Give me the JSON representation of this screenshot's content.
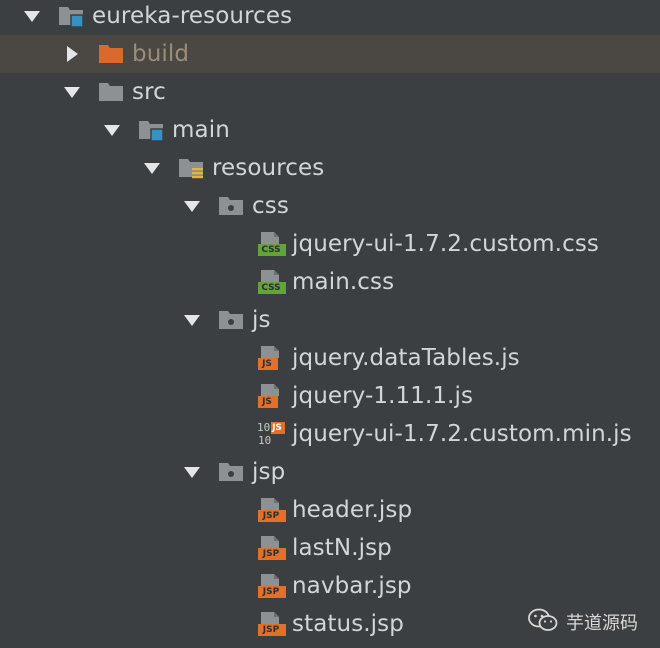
{
  "tree": [
    {
      "id": "eureka-resources",
      "label": "eureka-resources",
      "depth": 0,
      "toggle": "expanded",
      "icon": "module-folder-icon"
    },
    {
      "id": "build",
      "label": "build",
      "depth": 1,
      "toggle": "collapsed",
      "icon": "excluded-folder-icon",
      "selected": true,
      "dim": true
    },
    {
      "id": "src",
      "label": "src",
      "depth": 1,
      "toggle": "expanded",
      "icon": "folder-icon"
    },
    {
      "id": "main",
      "label": "main",
      "depth": 2,
      "toggle": "expanded",
      "icon": "source-folder-icon"
    },
    {
      "id": "resources",
      "label": "resources",
      "depth": 3,
      "toggle": "expanded",
      "icon": "resources-folder-icon"
    },
    {
      "id": "css",
      "label": "css",
      "depth": 4,
      "toggle": "expanded",
      "icon": "package-folder-icon"
    },
    {
      "id": "jquery-ui-1.7.2.custom.css",
      "label": "jquery-ui-1.7.2.custom.css",
      "depth": 5,
      "toggle": "none",
      "icon": "css-file-icon",
      "badge": "CSS",
      "badgeColor": "#62a33c"
    },
    {
      "id": "main.css",
      "label": "main.css",
      "depth": 5,
      "toggle": "none",
      "icon": "css-file-icon",
      "badge": "CSS",
      "badgeColor": "#62a33c"
    },
    {
      "id": "js",
      "label": "js",
      "depth": 4,
      "toggle": "expanded",
      "icon": "package-folder-icon"
    },
    {
      "id": "jquery.dataTables.js",
      "label": "jquery.dataTables.js",
      "depth": 5,
      "toggle": "none",
      "icon": "js-file-icon",
      "badge": "JS",
      "badgeColor": "#e0702c"
    },
    {
      "id": "jquery-1.11.1.js",
      "label": "jquery-1.11.1.js",
      "depth": 5,
      "toggle": "none",
      "icon": "js-file-icon",
      "badge": "JS",
      "badgeColor": "#e0702c"
    },
    {
      "id": "jquery-ui-1.7.2.custom.min.js",
      "label": "jquery-ui-1.7.2.custom.min.js",
      "depth": 5,
      "toggle": "none",
      "icon": "minified-js-file-icon",
      "badge": "JS",
      "badgeColor": "#e0702c",
      "binaryDigits": "1010"
    },
    {
      "id": "jsp",
      "label": "jsp",
      "depth": 4,
      "toggle": "expanded",
      "icon": "package-folder-icon"
    },
    {
      "id": "header.jsp",
      "label": "header.jsp",
      "depth": 5,
      "toggle": "none",
      "icon": "jsp-file-icon",
      "badge": "JSP",
      "badgeColor": "#e0702c"
    },
    {
      "id": "lastN.jsp",
      "label": "lastN.jsp",
      "depth": 5,
      "toggle": "none",
      "icon": "jsp-file-icon",
      "badge": "JSP",
      "badgeColor": "#e0702c"
    },
    {
      "id": "navbar.jsp",
      "label": "navbar.jsp",
      "depth": 5,
      "toggle": "none",
      "icon": "jsp-file-icon",
      "badge": "JSP",
      "badgeColor": "#e0702c"
    },
    {
      "id": "status.jsp",
      "label": "status.jsp",
      "depth": 5,
      "toggle": "none",
      "icon": "jsp-file-icon",
      "badge": "JSP",
      "badgeColor": "#e0702c"
    }
  ],
  "watermark": {
    "text": "芋道源码",
    "icon": "wechat-icon"
  },
  "colors": {
    "background": "#3c3f41",
    "selection": "#4b4742",
    "text": "#d3d6d8",
    "folder": "#8e9194",
    "moduleAccent": "#3592c4",
    "excluded": "#d96a2b",
    "resourcesAccent": "#e8b535",
    "cssBadge": "#62a33c",
    "jsBadge": "#e0702c"
  }
}
